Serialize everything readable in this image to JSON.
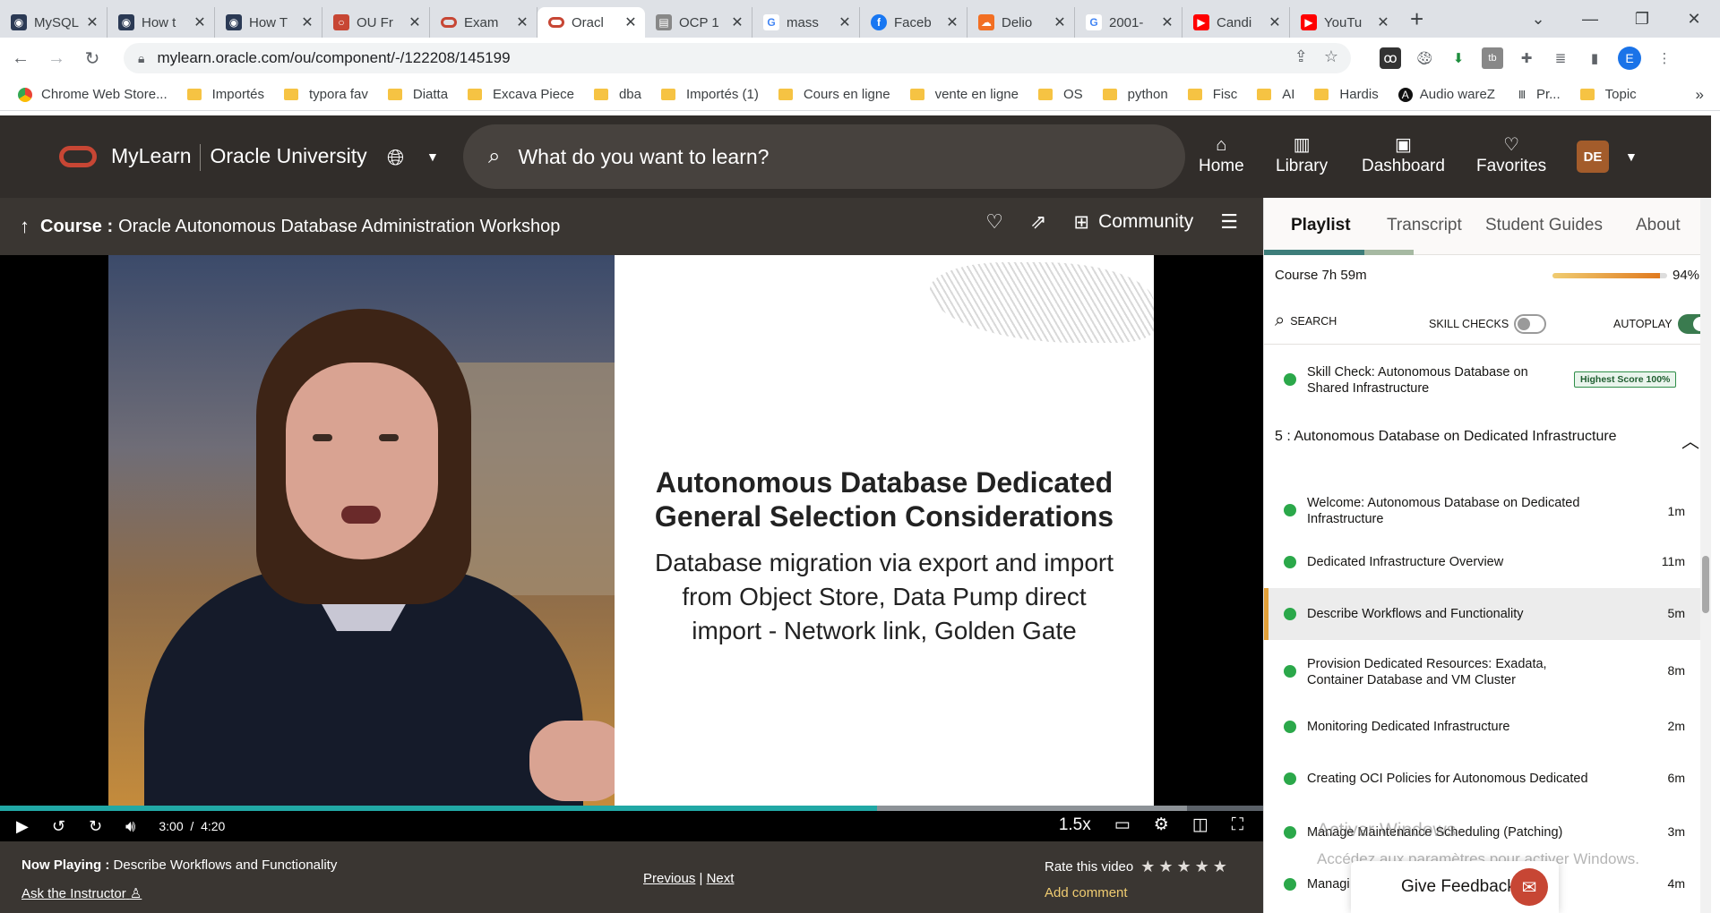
{
  "browser": {
    "tabs": [
      {
        "title": "MySQL",
        "favicon": "globe-icon",
        "color": "#334"
      },
      {
        "title": "How t",
        "favicon": "globe-icon",
        "color": "#334"
      },
      {
        "title": "How T",
        "favicon": "globe-icon",
        "color": "#334"
      },
      {
        "title": "OU Fr",
        "favicon": "oracle-icon",
        "color": "#c74634"
      },
      {
        "title": "Exam",
        "favicon": "oracle-icon",
        "color": "#c74634"
      },
      {
        "title": "Oracl",
        "favicon": "oracle-icon",
        "color": "#c74634"
      },
      {
        "title": "OCP 1",
        "favicon": "file-icon",
        "color": "#888"
      },
      {
        "title": "mass",
        "favicon": "google-icon",
        "color": "#4285f4"
      },
      {
        "title": "Faceb",
        "favicon": "facebook-icon",
        "color": "#1877f2"
      },
      {
        "title": "Delio",
        "favicon": "soundcloud-icon",
        "color": "#f26f23"
      },
      {
        "title": "2001-",
        "favicon": "google-icon",
        "color": "#4285f4"
      },
      {
        "title": "Candi",
        "favicon": "youtube-icon",
        "color": "#ff0000"
      },
      {
        "title": "YouTu",
        "favicon": "youtube-icon",
        "color": "#ff0000"
      }
    ],
    "url": "mylearn.oracle.com/ou/component/-/122208/145199",
    "profile_initial": "E",
    "bookmarks": [
      "Chrome Web Store...",
      "Importés",
      "typora fav",
      "Diatta",
      "Excava Piece",
      "dba",
      "Importés (1)",
      "Cours en ligne",
      "vente en ligne",
      "OS",
      "python",
      "Fisc",
      "AI",
      "Hardis",
      "Audio wareZ",
      "Pr...",
      "Topic"
    ]
  },
  "header": {
    "brand": "MyLearn",
    "sub_brand": "Oracle University",
    "search_placeholder": "What do you want to learn?",
    "nav": [
      {
        "label": "Home",
        "icon": "home-icon"
      },
      {
        "label": "Library",
        "icon": "library-icon"
      },
      {
        "label": "Dashboard",
        "icon": "dashboard-icon"
      },
      {
        "label": "Favorites",
        "icon": "heart-icon"
      }
    ],
    "avatar_initials": "DE"
  },
  "course": {
    "label": "Course",
    "title": "Oracle Autonomous Database Administration Workshop",
    "community_label": "Community"
  },
  "video": {
    "slide_title_1": "Autonomous Database Dedicated",
    "slide_title_2": "General Selection Considerations",
    "slide_body_1": "Database migration via export and import",
    "slide_body_2": "from Object Store, Data Pump direct",
    "slide_body_3": "import - Network link, Golden Gate",
    "current_time": "3:00",
    "duration": "4:20",
    "speed": "1.5x",
    "progress": 0.694,
    "buffered": 0.94
  },
  "now_playing": {
    "label": "Now Playing :",
    "title": "Describe Workflows and Functionality",
    "ask": "Ask the Instructor",
    "previous": "Previous",
    "next": "Next",
    "rate_label": "Rate this video",
    "stars": 5,
    "add_comment": "Add comment"
  },
  "panel": {
    "tabs": [
      "Playlist",
      "Transcript",
      "Student Guides",
      "About"
    ],
    "course_label": "Course",
    "course_duration": "7h 59m",
    "course_percent": "94%",
    "course_progress": 0.94,
    "search_label": "SEARCH",
    "skill_checks_label": "SKILL CHECKS",
    "autoplay_label": "AUTOPLAY",
    "skill_check": {
      "label": "Skill Check: Autonomous Database on Shared Infrastructure",
      "badge": "Highest Score 100%"
    },
    "section": "5 :  Autonomous Database on Dedicated Infrastructure",
    "items": [
      {
        "label": "Welcome: Autonomous Database on Dedicated Infrastructure",
        "duration": "1m"
      },
      {
        "label": "Dedicated Infrastructure Overview",
        "duration": "11m"
      },
      {
        "label": "Describe Workflows and Functionality",
        "duration": "5m"
      },
      {
        "label": "Provision Dedicated Resources: Exadata, Container Database and VM Cluster",
        "duration": "8m"
      },
      {
        "label": "Monitoring Dedicated Infrastructure",
        "duration": "2m"
      },
      {
        "label": "Creating OCI Policies for Autonomous Dedicated",
        "duration": "6m"
      },
      {
        "label": "Manage Maintenance Scheduling (Patching)",
        "duration": "3m"
      },
      {
        "label": "Managi",
        "duration": "4m"
      }
    ]
  },
  "overlay": {
    "windows_title": "Activer Windows",
    "windows_sub": "Accédez aux paramètres pour activer Windows.",
    "feedback": "Give Feedback"
  }
}
